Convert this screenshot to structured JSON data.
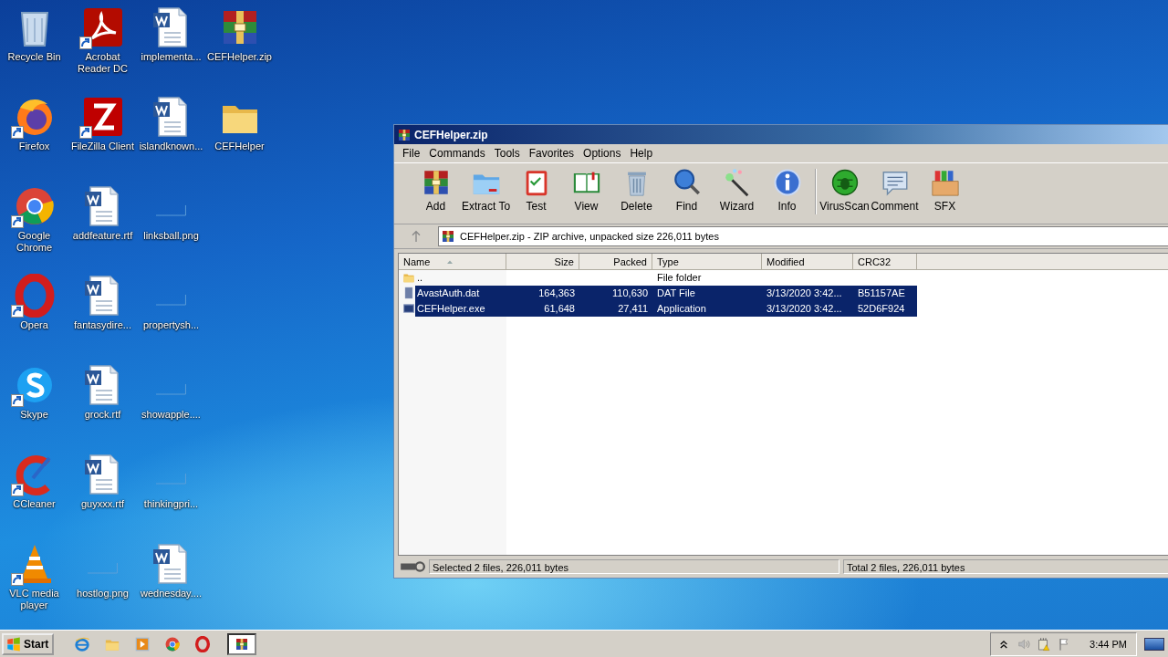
{
  "desktop": {
    "icons": [
      {
        "label": "Recycle Bin",
        "kind": "recycle-bin",
        "shortcut": false
      },
      {
        "label": "Firefox",
        "kind": "firefox",
        "shortcut": true
      },
      {
        "label": "Google Chrome",
        "kind": "chrome",
        "shortcut": true
      },
      {
        "label": "Opera",
        "kind": "opera",
        "shortcut": true
      },
      {
        "label": "Skype",
        "kind": "skype",
        "shortcut": true
      },
      {
        "label": "CCleaner",
        "kind": "ccleaner",
        "shortcut": true
      },
      {
        "label": "VLC media player",
        "kind": "vlc",
        "shortcut": true
      },
      {
        "label": "Acrobat Reader DC",
        "kind": "pdf",
        "shortcut": true
      },
      {
        "label": "FileZilla Client",
        "kind": "filezilla",
        "shortcut": true
      },
      {
        "label": "addfeature.rtf",
        "kind": "word",
        "shortcut": false
      },
      {
        "label": "fantasydire...",
        "kind": "word",
        "shortcut": false
      },
      {
        "label": "grock.rtf",
        "kind": "word",
        "shortcut": false
      },
      {
        "label": "guyxxx.rtf",
        "kind": "word",
        "shortcut": false
      },
      {
        "label": "hostlog.png",
        "kind": "image",
        "shortcut": false
      },
      {
        "label": "implementa...",
        "kind": "word",
        "shortcut": false
      },
      {
        "label": "islandknown...",
        "kind": "word",
        "shortcut": false
      },
      {
        "label": "linksball.png",
        "kind": "image",
        "shortcut": false
      },
      {
        "label": "propertysh...",
        "kind": "image",
        "shortcut": false
      },
      {
        "label": "showapple....",
        "kind": "image",
        "shortcut": false
      },
      {
        "label": "thinkingpri...",
        "kind": "image",
        "shortcut": false
      },
      {
        "label": "wednesday....",
        "kind": "word",
        "shortcut": false
      },
      {
        "label": "CEFHelper.zip",
        "kind": "archive",
        "shortcut": false
      },
      {
        "label": "CEFHelper",
        "kind": "folder",
        "shortcut": false
      }
    ]
  },
  "window": {
    "title": "CEFHelper.zip",
    "menu": [
      "File",
      "Commands",
      "Tools",
      "Favorites",
      "Options",
      "Help"
    ],
    "toolbar_groups": [
      {
        "buttons": [
          {
            "label": "Add",
            "kind": "add"
          },
          {
            "label": "Extract To",
            "kind": "extract"
          },
          {
            "label": "Test",
            "kind": "test"
          },
          {
            "label": "View",
            "kind": "view"
          },
          {
            "label": "Delete",
            "kind": "delete"
          },
          {
            "label": "Find",
            "kind": "find"
          },
          {
            "label": "Wizard",
            "kind": "wizard"
          },
          {
            "label": "Info",
            "kind": "info"
          }
        ]
      },
      {
        "buttons": [
          {
            "label": "VirusScan",
            "kind": "virusscan"
          },
          {
            "label": "Comment",
            "kind": "comment"
          },
          {
            "label": "SFX",
            "kind": "sfx"
          }
        ]
      }
    ],
    "address": "CEFHelper.zip - ZIP archive, unpacked size 226,011 bytes",
    "columns": [
      {
        "label": "Name",
        "sorted": true
      },
      {
        "label": "Size",
        "sorted": false
      },
      {
        "label": "Packed",
        "sorted": false
      },
      {
        "label": "Type",
        "sorted": false
      },
      {
        "label": "Modified",
        "sorted": false
      },
      {
        "label": "CRC32",
        "sorted": false
      }
    ],
    "rows": [
      {
        "kind": "folder",
        "name": "..",
        "type": "File folder",
        "selected": false
      },
      {
        "kind": "file",
        "name": "AvastAuth.dat",
        "size": "164,363",
        "packed": "110,630",
        "type": "DAT File",
        "modified": "3/13/2020 3:42...",
        "crc32": "B51157AE",
        "selected": true
      },
      {
        "kind": "exe",
        "name": "CEFHelper.exe",
        "size": "61,648",
        "packed": "27,411",
        "type": "Application",
        "modified": "3/13/2020 3:42...",
        "crc32": "52D6F924",
        "selected": true
      }
    ],
    "status": {
      "selected": "Selected 2 files, 226,011 bytes",
      "total": "Total 2 files, 226,011 bytes"
    }
  },
  "taskbar": {
    "start": "Start",
    "quick_launch": [
      {
        "kind": "ie"
      },
      {
        "kind": "explorer"
      },
      {
        "kind": "media"
      },
      {
        "kind": "chrome"
      },
      {
        "kind": "opera"
      }
    ],
    "tasks": [
      {
        "kind": "winrar",
        "selected": true
      }
    ],
    "tray": [
      {
        "kind": "chevron"
      },
      {
        "kind": "speaker"
      },
      {
        "kind": "network"
      },
      {
        "kind": "flag"
      }
    ],
    "clock": "3:44 PM"
  }
}
